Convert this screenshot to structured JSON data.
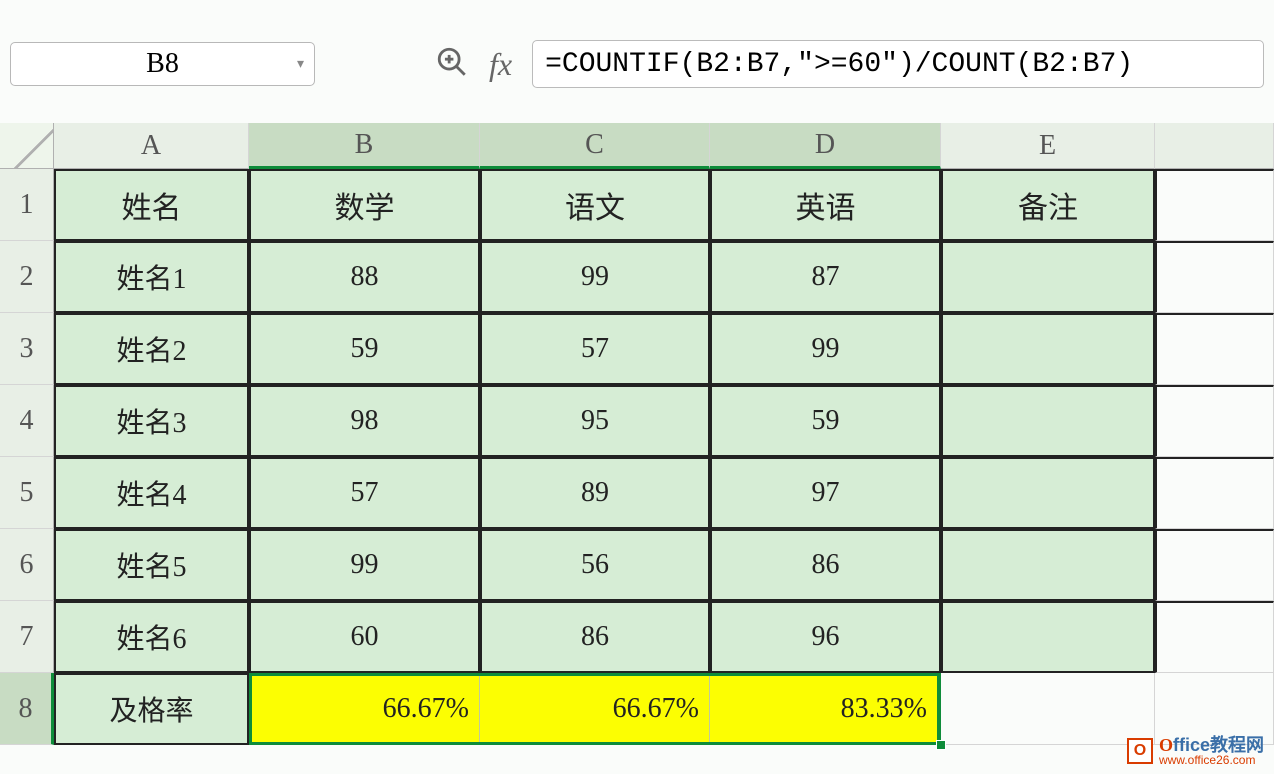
{
  "formulaBar": {
    "nameBox": "B8",
    "formula": "=COUNTIF(B2:B7,\">=60\")/COUNT(B2:B7)",
    "fxLabel": "fx"
  },
  "columns": [
    "A",
    "B",
    "C",
    "D",
    "E"
  ],
  "rowNumbers": [
    "1",
    "2",
    "3",
    "4",
    "5",
    "6",
    "7",
    "8"
  ],
  "headers": {
    "A": "姓名",
    "B": "数学",
    "C": "语文",
    "D": "英语",
    "E": "备注"
  },
  "rows": [
    {
      "A": "姓名1",
      "B": "88",
      "C": "99",
      "D": "87",
      "E": ""
    },
    {
      "A": "姓名2",
      "B": "59",
      "C": "57",
      "D": "99",
      "E": ""
    },
    {
      "A": "姓名3",
      "B": "98",
      "C": "95",
      "D": "59",
      "E": ""
    },
    {
      "A": "姓名4",
      "B": "57",
      "C": "89",
      "D": "97",
      "E": ""
    },
    {
      "A": "姓名5",
      "B": "99",
      "C": "56",
      "D": "86",
      "E": ""
    },
    {
      "A": "姓名6",
      "B": "60",
      "C": "86",
      "D": "96",
      "E": ""
    }
  ],
  "summaryRow": {
    "label": "及格率",
    "B": "66.67%",
    "C": "66.67%",
    "D": "83.33%"
  },
  "watermark": {
    "brand1": "O",
    "brand2": "ffice",
    "brandCn": "教程网",
    "url": "www.office26.com"
  },
  "chart_data": {
    "type": "table",
    "title": "",
    "columns": [
      "姓名",
      "数学",
      "语文",
      "英语",
      "备注"
    ],
    "data": [
      [
        "姓名1",
        88,
        99,
        87,
        ""
      ],
      [
        "姓名2",
        59,
        57,
        99,
        ""
      ],
      [
        "姓名3",
        98,
        95,
        59,
        ""
      ],
      [
        "姓名4",
        57,
        89,
        97,
        ""
      ],
      [
        "姓名5",
        99,
        56,
        86,
        ""
      ],
      [
        "姓名6",
        60,
        86,
        96,
        ""
      ]
    ],
    "summary": {
      "label": "及格率",
      "数学": "66.67%",
      "语文": "66.67%",
      "英语": "83.33%"
    }
  }
}
